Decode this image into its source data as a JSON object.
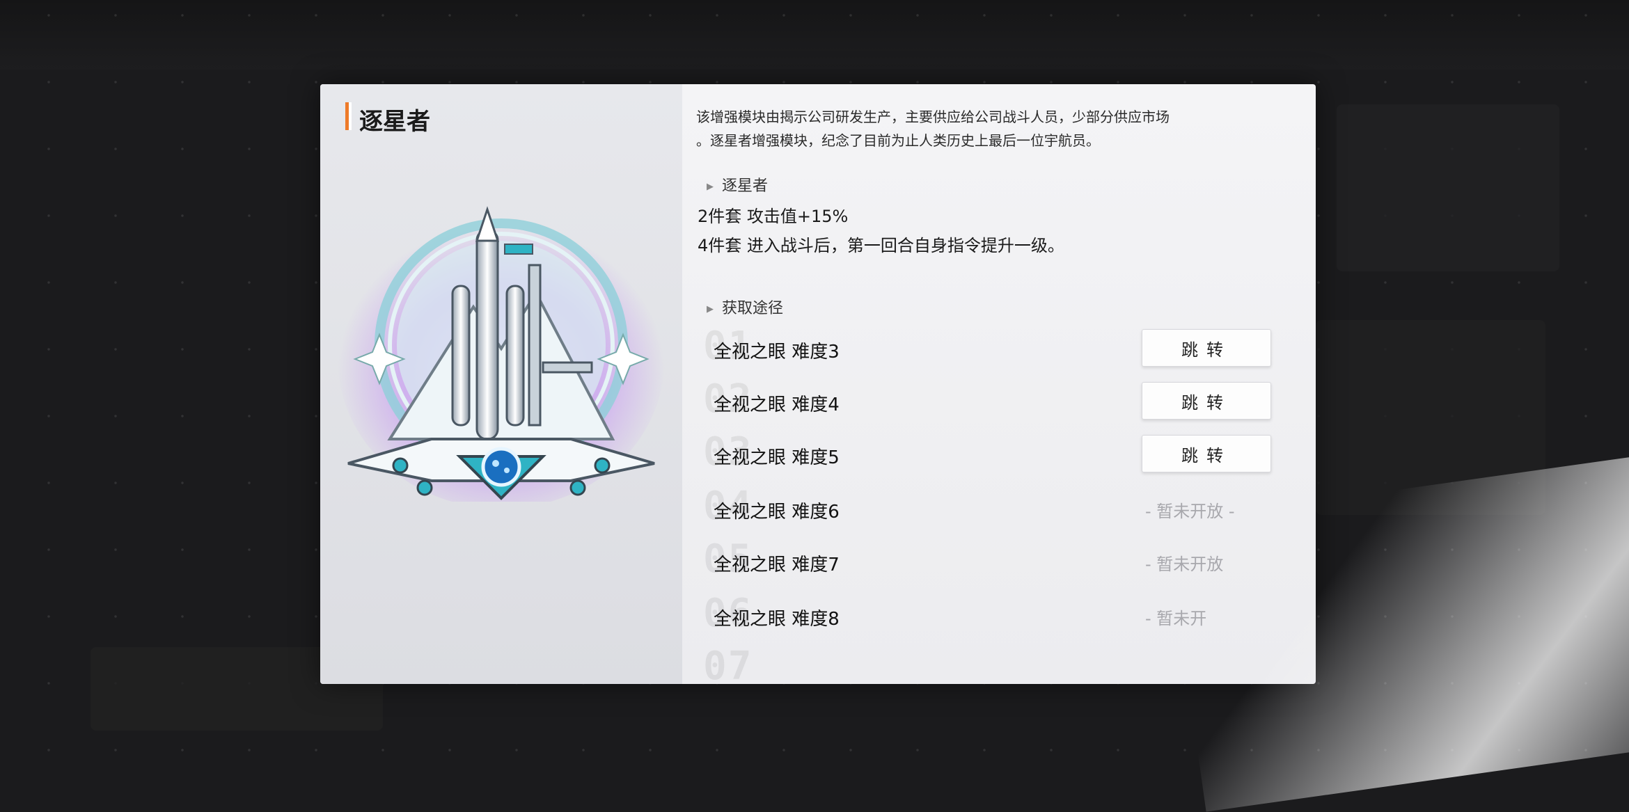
{
  "item": {
    "name": "逐星者",
    "description": "该增强模块由揭示公司研发生产，主要供应给公司战斗人员，少部分供应市场。逐星者增强模块，纪念了目前为止人类历史上最后一位宇航员。",
    "desc_line1": "该增强模块由揭示公司研发生产，主要供应给公司战斗人员，少部分供应市场",
    "desc_line2": "。逐星者增强模块，纪念了目前为止人类历史上最后一位宇航员。"
  },
  "set_section": {
    "title": "逐星者",
    "effects": [
      "2件套 攻击值+15%",
      "4件套 进入战斗后，第一回合自身指令提升一级。"
    ]
  },
  "sources_section": {
    "title": "获取途径",
    "rows": [
      {
        "num": "01",
        "name": "全视之眼  难度3",
        "action": "跳转",
        "state": "open"
      },
      {
        "num": "02",
        "name": "全视之眼  难度4",
        "action": "跳转",
        "state": "open"
      },
      {
        "num": "03",
        "name": "全视之眼  难度5",
        "action": "跳转",
        "state": "open"
      },
      {
        "num": "04",
        "name": "全视之眼  难度6",
        "action": "- 暂未开放 -",
        "state": "locked"
      },
      {
        "num": "05",
        "name": "全视之眼  难度7",
        "action": "- 暂未开放",
        "state": "locked"
      },
      {
        "num": "06",
        "name": "全视之眼  难度8",
        "action": "- 暂未开",
        "state": "locked"
      }
    ],
    "partial_num": "07"
  },
  "colors": {
    "accent": "#ee7b2a",
    "emblem_glow": "#c9a0f0",
    "emblem_teal": "#2fb3c4"
  },
  "icons": {
    "section_arrow": "triangle-right-icon",
    "emblem": "rocket-emblem-icon"
  }
}
